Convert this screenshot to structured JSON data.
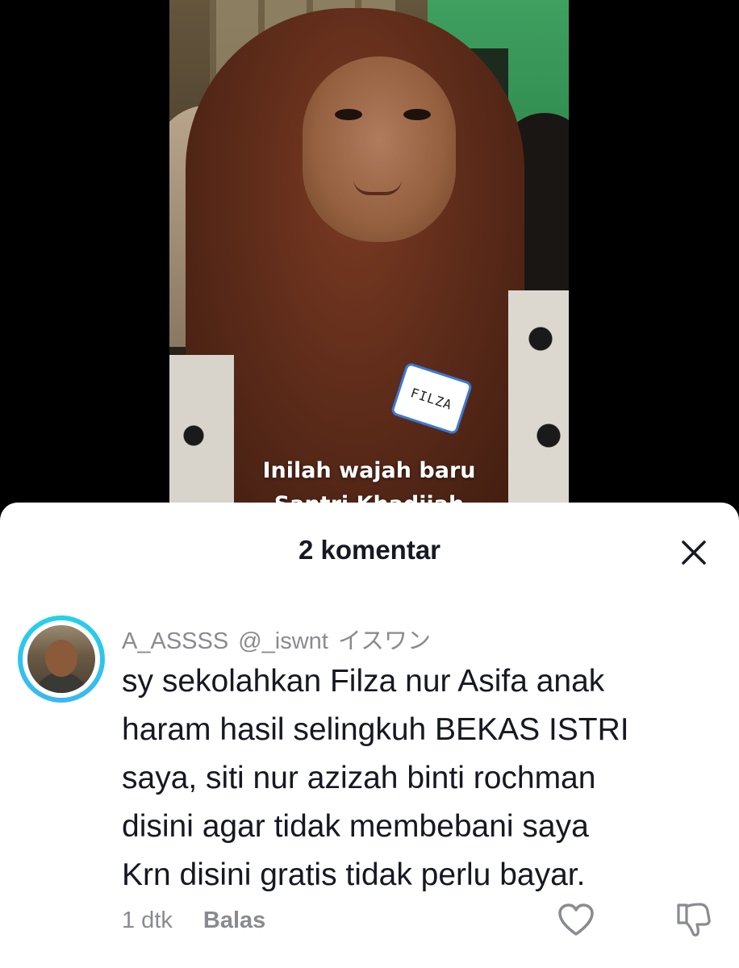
{
  "video": {
    "name_tag": "FILZA",
    "caption_line1": "Inilah wajah baru",
    "caption_line2": "Santri Khadijah"
  },
  "sheet": {
    "title": "2 komentar",
    "close_icon": "close-icon"
  },
  "comment": {
    "display_name": "A_ASSSS",
    "handle": "@_iswnt",
    "nickname": "イスワン",
    "text_lines": [
      "sy sekolahkan Filza nur Asifa anak",
      "haram hasil selingkuh BEKAS ISTRI",
      "saya, siti nur azizah binti rochman",
      "disini agar tidak membebani saya",
      "Krn disini gratis tidak perlu bayar."
    ],
    "time": "1 dtk",
    "reply_label": "Balas",
    "like_icon": "heart-icon",
    "dislike_icon": "thumbs-down-icon",
    "avatar_ring_color": "#23d3e8"
  }
}
